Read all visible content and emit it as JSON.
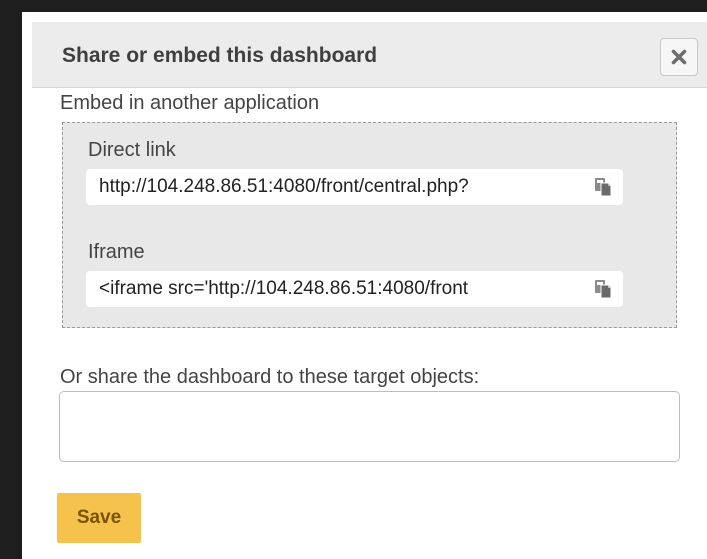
{
  "dialog": {
    "title": "Share or embed this dashboard",
    "close_icon": "close-icon"
  },
  "embed": {
    "section_label": "Embed in another application",
    "direct_link": {
      "label": "Direct link",
      "value": "http://104.248.86.51:4080/front/central.php?",
      "copy_icon": "copy-icon"
    },
    "iframe": {
      "label": "Iframe",
      "value": "<iframe src='http://104.248.86.51:4080/front",
      "copy_icon": "copy-icon"
    }
  },
  "share": {
    "label": "Or share the dashboard to these target objects:",
    "value": ""
  },
  "actions": {
    "save_label": "Save"
  },
  "colors": {
    "save_button": "#f5c24b",
    "header_background": "#ececec",
    "embed_box_background": "#e8e8e8"
  }
}
